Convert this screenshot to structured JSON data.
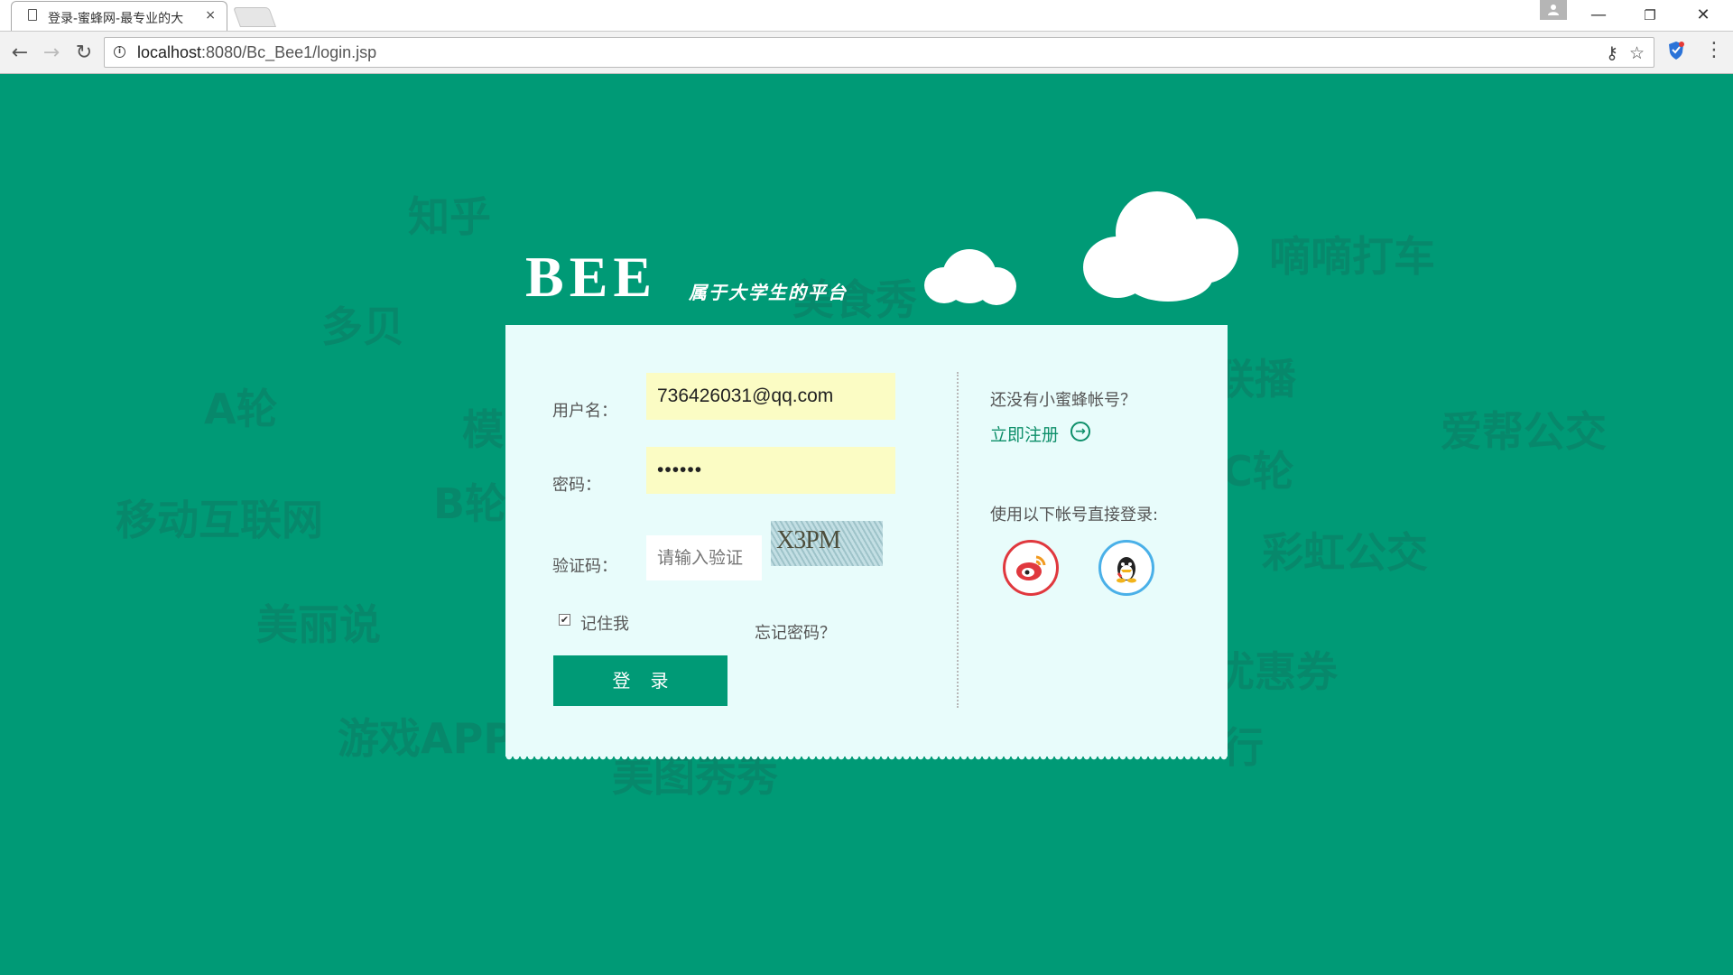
{
  "browser": {
    "tab_title": "登录-蜜蜂网-最专业的大",
    "tab_close": "×",
    "url_host": "localhost",
    "url_path": ":8080/Bc_Bee1/login.jsp",
    "window_minimize": "—",
    "window_restore": "❐",
    "window_close": "✕",
    "back_glyph": "←",
    "forward_glyph": "→",
    "reload_glyph": "↻",
    "star_glyph": "☆",
    "key_glyph": "⚷",
    "menu_glyph": "⋮",
    "icons": [
      "page-icon",
      "profile-icon",
      "info-icon",
      "key-icon",
      "star-icon",
      "shield-extension-icon",
      "menu-icon"
    ]
  },
  "logo": {
    "brand": "BEE",
    "slogan": "属于大学生的平台"
  },
  "background_words": [
    "知乎",
    "多贝",
    "A轮",
    "模",
    "B轮",
    "移动互联网",
    "美丽说",
    "游戏APP",
    "美图秀秀",
    "嘀嘀打车",
    "联播",
    "爱帮公交",
    "C轮",
    "彩虹公交",
    "优惠券",
    "行",
    "美食秀"
  ],
  "form": {
    "username_label": "用户名：",
    "username_value": "736426031@qq.com",
    "password_label": "密码：",
    "password_value": "••••••",
    "captcha_label": "验证码：",
    "captcha_placeholder": "请输入验证",
    "captcha_text": "X3PM",
    "remember_checked": true,
    "remember_label": "记住我",
    "forgot_password": "忘记密码？",
    "login_button": "登录"
  },
  "side": {
    "no_account_text": "还没有小蜜蜂帐号？",
    "register_link": "立即注册",
    "register_arrow": "→",
    "social_title": "使用以下帐号直接登录:",
    "social_icons": [
      "weibo-icon",
      "qq-icon"
    ]
  },
  "colors": {
    "page_background": "#009a76",
    "panel_background": "#e8fcfb",
    "filled_input": "#fbfcc4",
    "accent": "#009a76",
    "link": "#0e8f6a",
    "weibo_red": "#e0383e",
    "qq_blue": "#4ab0e8"
  }
}
